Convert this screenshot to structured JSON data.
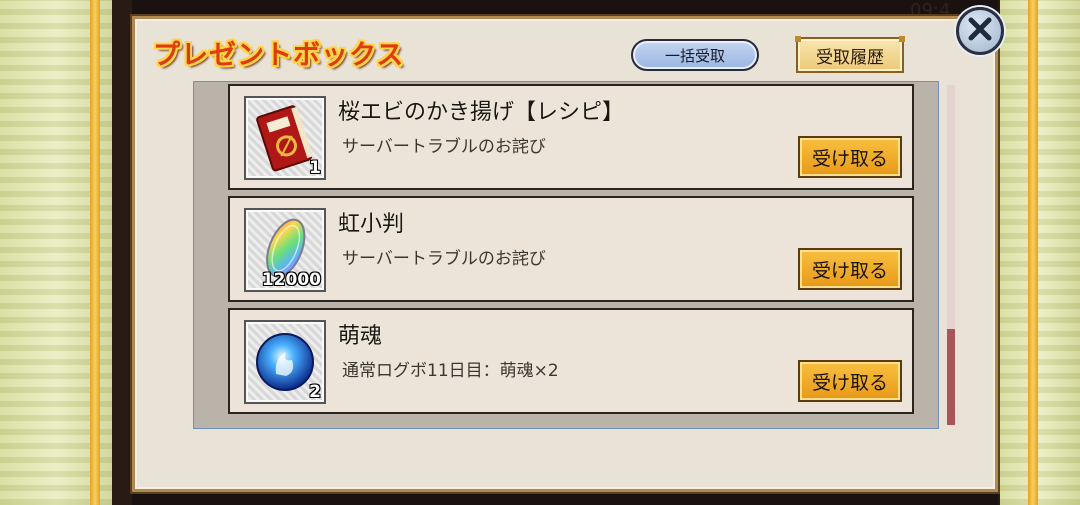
{
  "status_bar": {
    "clock": "09:4"
  },
  "dialog": {
    "title": "プレゼントボックス",
    "bulk_receive_label": "一括受取",
    "history_label": "受取履歴",
    "close_symbol": "✕"
  },
  "items": [
    {
      "name": "桜エビのかき揚げ【レシピ】",
      "description": "サーバートラブルのお詫び",
      "quantity": "1",
      "icon": "recipe-book-icon",
      "button_label": "受け取る"
    },
    {
      "name": "虹小判",
      "description": "サーバートラブルのお詫び",
      "quantity": "12000",
      "icon": "rainbow-koban-icon",
      "button_label": "受け取る"
    },
    {
      "name": "萌魂",
      "description": "通常ログボ11日目：萌魂×2",
      "quantity": "2",
      "icon": "blue-soul-orb-icon",
      "button_label": "受け取る"
    }
  ],
  "scrollbar": {
    "position": 0.72
  },
  "colors": {
    "title": "#e03a10",
    "title_outline": "#ffd44a",
    "receive_button": "#f0a828",
    "bulk_button": "#9ab6e2",
    "scroll_thumb": "#a8565a"
  }
}
